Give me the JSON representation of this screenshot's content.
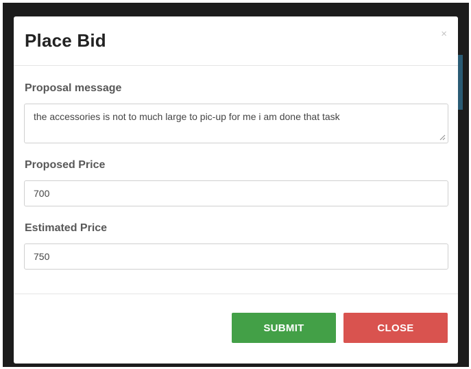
{
  "modal": {
    "title": "Place Bid",
    "close_symbol": "×",
    "close_icon": "close-icon"
  },
  "fields": {
    "proposal": {
      "label": "Proposal message",
      "value": "the accessories is not to much large to pic-up for me i am done that task"
    },
    "proposed_price": {
      "label": "Proposed Price",
      "value": "700"
    },
    "estimated_price": {
      "label": "Estimated Price",
      "value": "750"
    }
  },
  "buttons": {
    "submit_label": "SUBMIT",
    "close_label": "CLOSE"
  },
  "colors": {
    "submit": "#43a047",
    "close": "#d9534f",
    "title": "#222222",
    "label": "#585858"
  }
}
